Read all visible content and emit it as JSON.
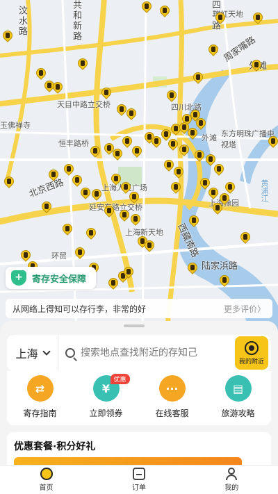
{
  "map": {
    "labels": [
      {
        "id": "label-wenshui",
        "text": "汶水路",
        "vertical": true
      },
      {
        "id": "label-gonghexin",
        "text": "共和新路",
        "vertical": true
      },
      {
        "id": "label-siping",
        "text": "四平路",
        "vertical": true
      },
      {
        "id": "label-ruihong",
        "text": "瑞虹天地",
        "vertical": false
      },
      {
        "id": "label-zhoujiazui",
        "text": "周家嘴路",
        "vertical": false
      },
      {
        "id": "label-waihuan",
        "text": "外滩",
        "vertical": false
      },
      {
        "id": "label-tianmu",
        "text": "天目中路立交桥",
        "vertical": false
      },
      {
        "id": "label-yufo",
        "text": "玉佛禅寺",
        "vertical": false
      },
      {
        "id": "label-hengfeng",
        "text": "恒丰路桥",
        "vertical": false
      },
      {
        "id": "label-sichuan",
        "text": "四川北路",
        "vertical": false
      },
      {
        "id": "label-dongfang",
        "text": "东方明珠广播电视塔",
        "vertical": false
      },
      {
        "id": "label-beijing",
        "text": "北京西路",
        "vertical": false
      },
      {
        "id": "label-peoples",
        "text": "上海人民广场",
        "vertical": false
      },
      {
        "id": "label-yanan",
        "text": "延安东路立交桥",
        "vertical": false
      },
      {
        "id": "label-xintiandi",
        "text": "上海新天地",
        "vertical": false
      },
      {
        "id": "label-xizang",
        "text": "西藏南路",
        "vertical": false
      },
      {
        "id": "label-lujiabang",
        "text": "陆家浜路",
        "vertical": false
      },
      {
        "id": "label-huanmao",
        "text": "环贸",
        "vertical": false
      },
      {
        "id": "label-yuyuan",
        "text": "上海豫园",
        "vertical": false
      },
      {
        "id": "label-waitan2",
        "text": "外滩",
        "vertical": false
      },
      {
        "id": "label-pujiang",
        "text": "黄浦江",
        "vertical": false
      }
    ]
  },
  "safety": {
    "label": "寄存安全保障",
    "icon": "shield-icon"
  },
  "review": {
    "question": "从网络上得知可以存行李，非常的好",
    "more": "更多评价〉"
  },
  "search": {
    "city": "上海",
    "placeholder": "搜索地点查找附近的存知己",
    "nearby_label": "我的附近"
  },
  "tools": [
    {
      "label": "寄存指南",
      "icon": "guide-icon",
      "color": "#f5a623"
    },
    {
      "label": "立即领券",
      "icon": "coupon-icon",
      "color": "#3ac0b2",
      "badge": "优惠"
    },
    {
      "label": "在线客服",
      "icon": "chat-icon",
      "color": "#f5a623"
    },
    {
      "label": "旅游攻略",
      "icon": "guidebook-icon",
      "color": "#3ac0b2"
    }
  ],
  "promo": {
    "title": "优惠套餐·积分好礼"
  },
  "tabs": [
    {
      "label": "首页",
      "icon": "home-icon"
    },
    {
      "label": "订单",
      "icon": "order-icon"
    },
    {
      "label": "我的",
      "icon": "profile-icon"
    }
  ],
  "colors": {
    "brand_yellow": "#f6c518",
    "teal": "#3ac0b2",
    "orange": "#f5a623"
  }
}
